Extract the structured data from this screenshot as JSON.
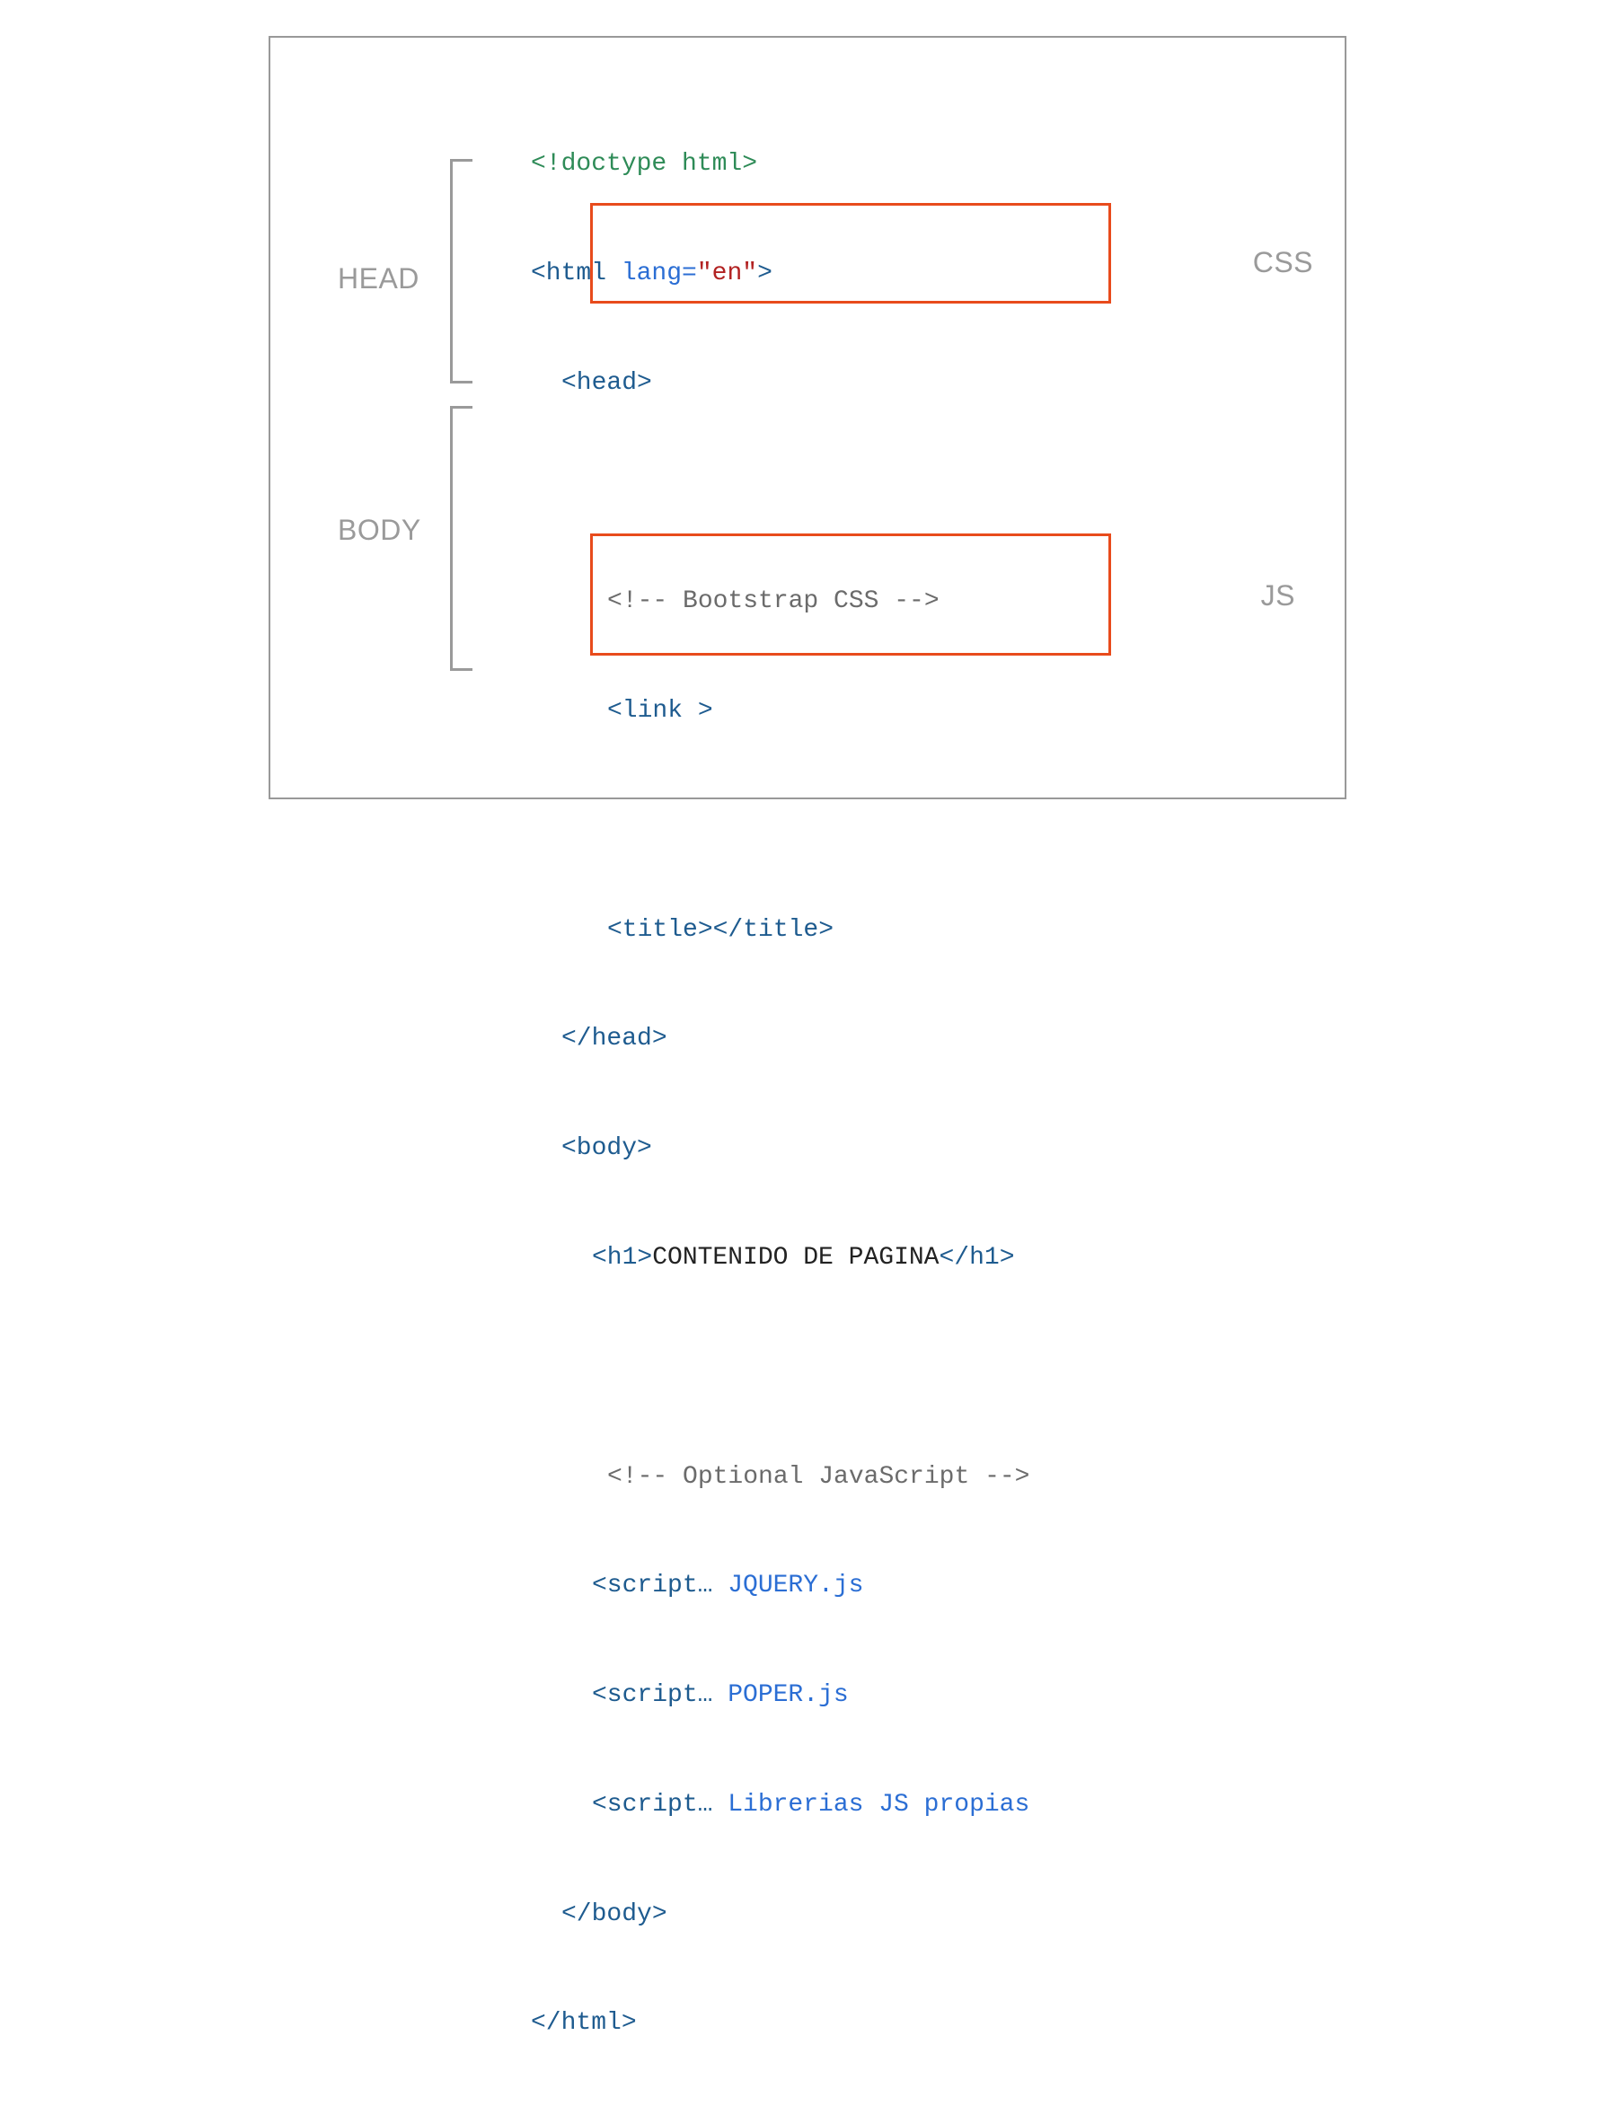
{
  "labels": {
    "head": "HEAD",
    "body": "BODY",
    "css": "CSS",
    "js": "JS"
  },
  "code": {
    "doctype": "<!doctype html>",
    "html_open_tag": "<html",
    "html_lang_attr": " lang=",
    "html_lang_val": "\"en\"",
    "html_open_close": ">",
    "head_open": "<head>",
    "comment_css": "<!-- Bootstrap CSS -->",
    "link_tag": "<link >",
    "title_tag": "<title></title>",
    "head_close": "</head>",
    "body_open": "<body>",
    "h1_open": "<h1>",
    "h1_content": "CONTENIDO DE PAGINA",
    "h1_close": "</h1>",
    "comment_js": "<!-- Optional JavaScript -->",
    "script1_tag": "<script…",
    "script1_lib": " JQUERY.js",
    "script2_tag": "<script…",
    "script2_lib": " POPER.js",
    "script3_tag": "<script…",
    "script3_lib": " Librerias JS propias",
    "body_close": "</body>",
    "html_close": "</html>"
  }
}
